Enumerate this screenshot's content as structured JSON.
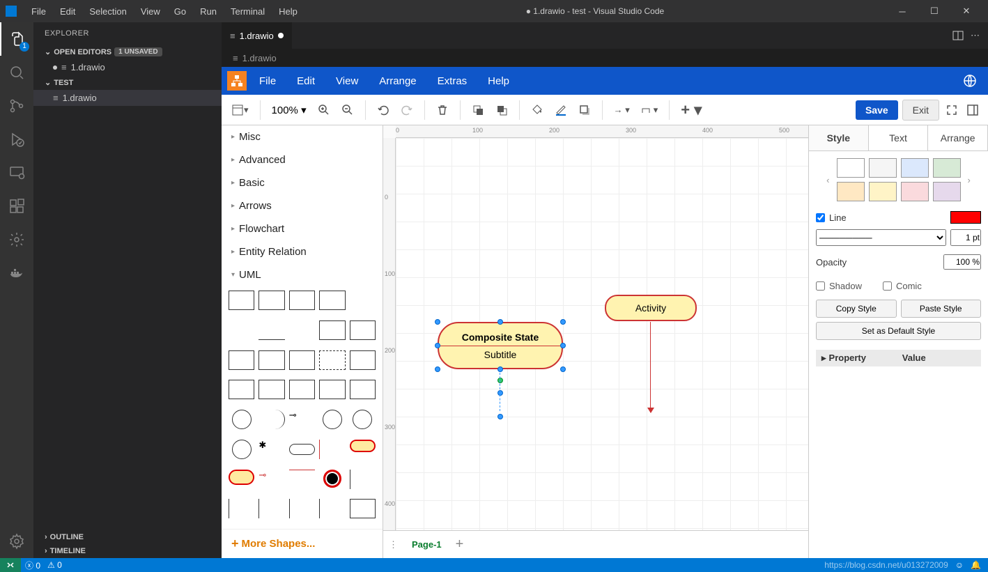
{
  "titlebar": {
    "menus": [
      "File",
      "Edit",
      "Selection",
      "View",
      "Go",
      "Run",
      "Terminal",
      "Help"
    ],
    "title": "● 1.drawio - test - Visual Studio Code"
  },
  "activitybar": {
    "explorer_badge": "1"
  },
  "sidebar": {
    "header": "EXPLORER",
    "open_editors_label": "OPEN EDITORS",
    "unsaved_badge": "1 UNSAVED",
    "open_editor_file": "1.drawio",
    "workspace_label": "TEST",
    "workspace_file": "1.drawio",
    "outline_label": "OUTLINE",
    "timeline_label": "TIMELINE"
  },
  "tab": {
    "name": "1.drawio"
  },
  "breadcrumb": {
    "file": "1.drawio"
  },
  "drawio": {
    "menus": [
      "File",
      "Edit",
      "View",
      "Arrange",
      "Extras",
      "Help"
    ],
    "zoom": "100%",
    "save": "Save",
    "exit": "Exit",
    "categories": [
      "Misc",
      "Advanced",
      "Basic",
      "Arrows",
      "Flowchart",
      "Entity Relation",
      "UML"
    ],
    "more_shapes": "More Shapes...",
    "page_tab": "Page-1",
    "ruler_h": [
      "0",
      "100",
      "200",
      "300",
      "400",
      "500"
    ],
    "ruler_v": [
      "0",
      "100",
      "200",
      "300",
      "400"
    ]
  },
  "canvas": {
    "composite_title": "Composite State",
    "composite_subtitle": "Subtitle",
    "activity_label": "Activity"
  },
  "right_panel": {
    "tabs": [
      "Style",
      "Text",
      "Arrange"
    ],
    "swatches": [
      "#ffffff",
      "#f5f5f5",
      "#dbe8fc",
      "#d7ead6",
      "#ffe8c3",
      "#fff4c7",
      "#fadadd",
      "#e6d9ec"
    ],
    "line_label": "Line",
    "line_color": "#ff0000",
    "line_pt": "1 pt",
    "opacity_label": "Opacity",
    "opacity_value": "100 %",
    "shadow_label": "Shadow",
    "comic_label": "Comic",
    "copy_style": "Copy Style",
    "paste_style": "Paste Style",
    "default_style": "Set as Default Style",
    "property_col": "Property",
    "value_col": "Value"
  },
  "statusbar": {
    "errors": "0",
    "warnings": "0",
    "watermark": "https://blog.csdn.net/u013272009"
  }
}
